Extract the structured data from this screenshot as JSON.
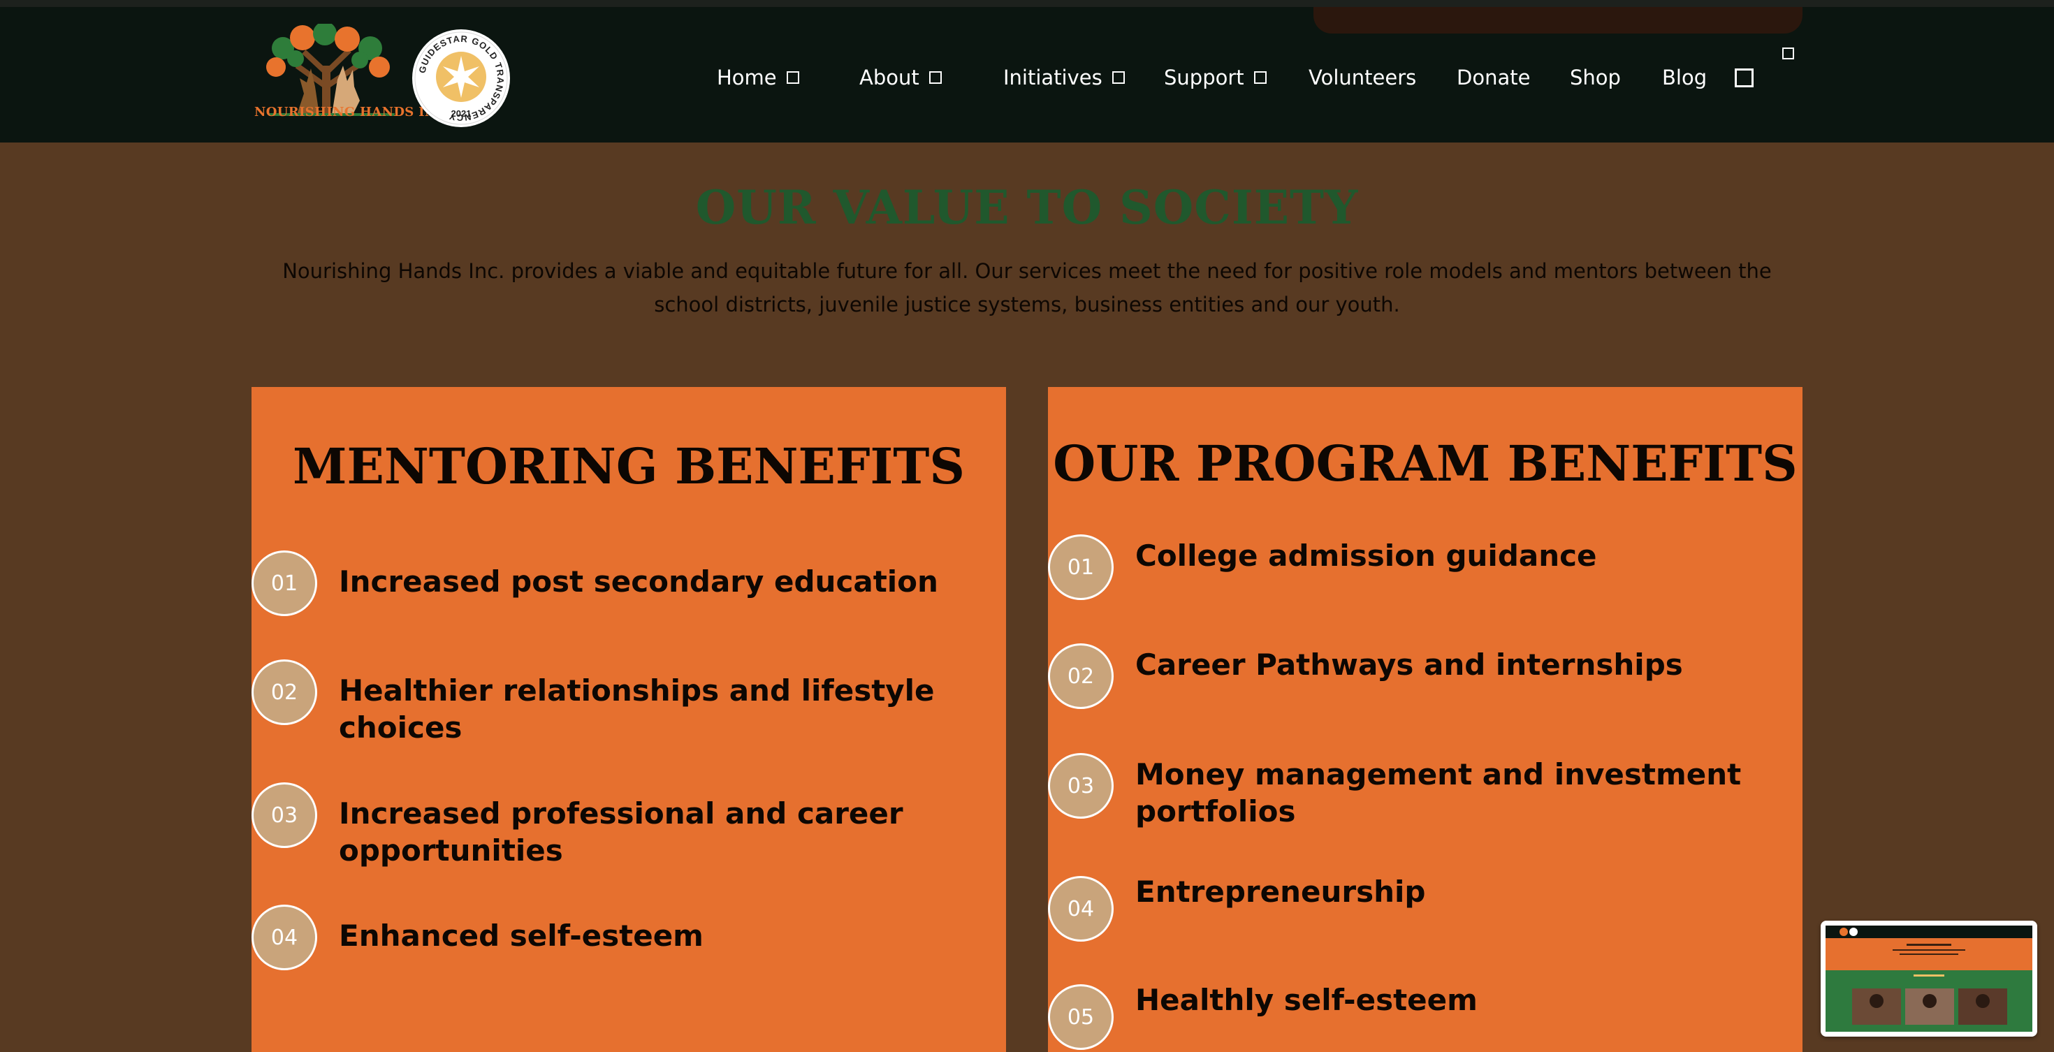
{
  "header": {
    "logo_text": "NOURISHING HANDS INC.",
    "seal_ring_text": "GUIDESTAR GOLD TRANSPARENCY",
    "seal_year": "2021",
    "nav": [
      {
        "label": "Home",
        "has_dropdown": true
      },
      {
        "label": "About",
        "has_dropdown": true
      },
      {
        "label": "Initiatives",
        "has_dropdown": true
      },
      {
        "label": "Support",
        "has_dropdown": true
      },
      {
        "label": "Volunteers",
        "has_dropdown": false
      },
      {
        "label": "Donate",
        "has_dropdown": false
      },
      {
        "label": "Shop",
        "has_dropdown": false
      },
      {
        "label": "Blog",
        "has_dropdown": false
      }
    ]
  },
  "intro": {
    "title": "OUR VALUE TO SOCIETY",
    "description": "Nourishing Hands Inc. provides a viable and equitable future for all. Our services meet the need for positive role models and mentors between the school districts, juvenile justice systems, business entities and our youth."
  },
  "mentoring": {
    "title": "MENTORING BENEFITS",
    "items": [
      {
        "num": "01",
        "text": "Increased post secondary education"
      },
      {
        "num": "02",
        "text": "Healthier relationships and lifestyle choices"
      },
      {
        "num": "03",
        "text": "Increased professional and career opportunities"
      },
      {
        "num": "04",
        "text": "Enhanced self-esteem"
      }
    ]
  },
  "program": {
    "title": "OUR PROGRAM BENEFITS",
    "items": [
      {
        "num": "01",
        "text": "College admission guidance"
      },
      {
        "num": "02",
        "text": "Career Pathways and internships"
      },
      {
        "num": "03",
        "text": "Money management and investment portfolios"
      },
      {
        "num": "04",
        "text": "Entrepreneurship"
      },
      {
        "num": "05",
        "text": "Healthly self-esteem"
      }
    ]
  },
  "colors": {
    "page_bg": "#583a22",
    "header_bg": "#0b1510",
    "card_bg": "#e6702f",
    "accent_green": "#20582d",
    "circle_fill": "#c9a47b"
  }
}
